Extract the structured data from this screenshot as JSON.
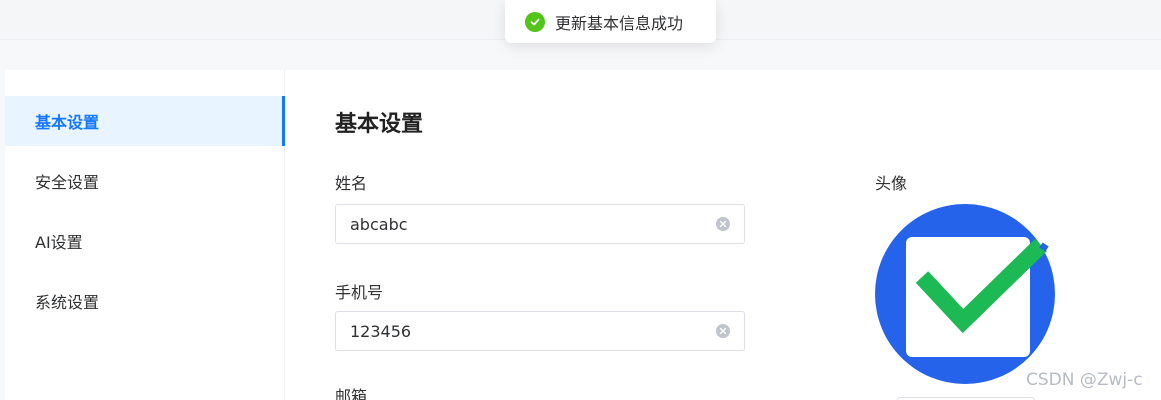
{
  "toast": {
    "icon": "success-check-icon",
    "message": "更新基本信息成功",
    "color": "#52c41a"
  },
  "sidebar": {
    "items": [
      {
        "label": "基本设置",
        "active": true
      },
      {
        "label": "安全设置",
        "active": false
      },
      {
        "label": "AI设置",
        "active": false
      },
      {
        "label": "系统设置",
        "active": false
      }
    ],
    "active_color": "#1677ff"
  },
  "main": {
    "title": "基本设置",
    "fields": {
      "name": {
        "label": "姓名",
        "value": "abcabc"
      },
      "phone": {
        "label": "手机号",
        "value": "123456"
      },
      "email": {
        "label": "邮箱"
      }
    },
    "avatar": {
      "label": "头像",
      "icon": "checkmark-avatar-icon",
      "circle_color": "#2563eb",
      "check_color": "#1db954"
    }
  },
  "watermark": "CSDN @Zwj-c"
}
